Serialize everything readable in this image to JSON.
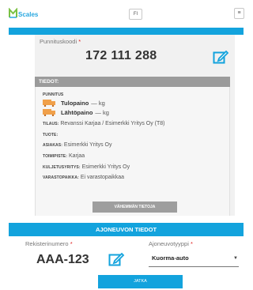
{
  "header": {
    "brand": "Scales",
    "language": "FI",
    "menu_glyph": "≡"
  },
  "weighing": {
    "code_label": "Punnituskoodi",
    "code_value": "172 111 288"
  },
  "info": {
    "title": "TIEDOT:",
    "section_label": "PUNNITUS",
    "inbound_label": "Tulopaino",
    "inbound_value": "— kg",
    "outbound_label": "Lähtöpaino",
    "outbound_value": "— kg",
    "order_label": "TILAUS:",
    "order_value": "Revanssi Karjaa / Esimerkki Yritys Oy (T8)",
    "product_label": "TUOTE:",
    "product_value": "",
    "customer_label": "ASIAKAS:",
    "customer_value": "Esimerkki Yritys Oy",
    "delivery_label": "TOIMIPISTE:",
    "delivery_value": "Karjaa",
    "carrier_label": "KULJETUSYRITYS:",
    "carrier_value": "Esimerkki Yritys Oy",
    "storage_label": "VARASTOPAIKKA:",
    "storage_value": "Ei varastopaikkaa",
    "less_button": "VÄHEMMÄN TIETOJA"
  },
  "vehicle": {
    "section_title": "AJONEUVON TIEDOT",
    "reg_label": "Rekisterinumero",
    "reg_value": "AAA-123",
    "type_label": "Ajoneuvotyyppi",
    "type_value": "Kuorma-auto",
    "next_button": "JATKA"
  },
  "colors": {
    "accent": "#13a3dd",
    "truck_icon": "#f0a04a",
    "required": "#e02020"
  }
}
